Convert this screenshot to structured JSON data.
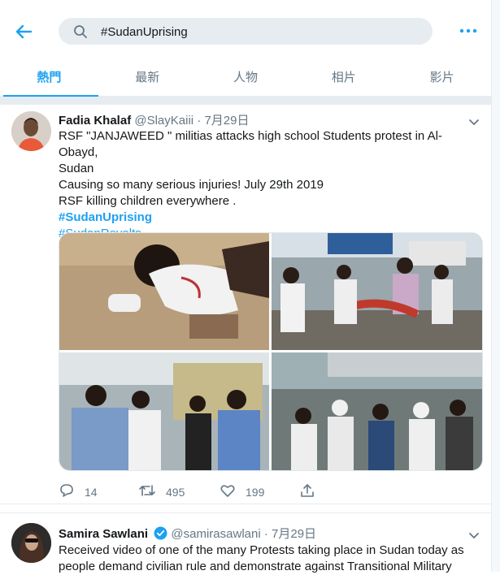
{
  "search": {
    "query": "#SudanUprising"
  },
  "tabs": [
    {
      "label": "熱門",
      "active": true
    },
    {
      "label": "最新"
    },
    {
      "label": "人物"
    },
    {
      "label": "相片"
    },
    {
      "label": "影片"
    }
  ],
  "tweets": [
    {
      "name": "Fadia Khalaf",
      "handle": "@SlayKaiii",
      "dot": "·",
      "date": "7月29日",
      "lines": [
        "RSF \"JANJAWEED \" militias attacks high school Students protest in Al-Obayd,",
        "Sudan",
        "Causing so many serious injuries! July 29th 2019",
        "RSF killing children everywhere ."
      ],
      "hashtags": [
        "#SudanUprising",
        "#SudanRevolts"
      ],
      "replies": "14",
      "retweets": "495",
      "likes": "199"
    },
    {
      "name": "Samira Sawlani",
      "handle": "@samirasawlani",
      "dot": "·",
      "date": "7月29日",
      "lines": [
        "Received video of one of the many Protests taking place in Sudan today as",
        "people demand civilian rule and demonstrate against Transitional Military"
      ]
    }
  ],
  "colors": {
    "accent": "#1da1f2",
    "muted": "#657786",
    "divider": "#e6ecf0"
  },
  "icons": [
    "back-arrow-icon",
    "search-icon",
    "more-icon",
    "chevron-down-icon",
    "reply-icon",
    "retweet-icon",
    "like-icon",
    "share-icon",
    "verified-icon"
  ]
}
